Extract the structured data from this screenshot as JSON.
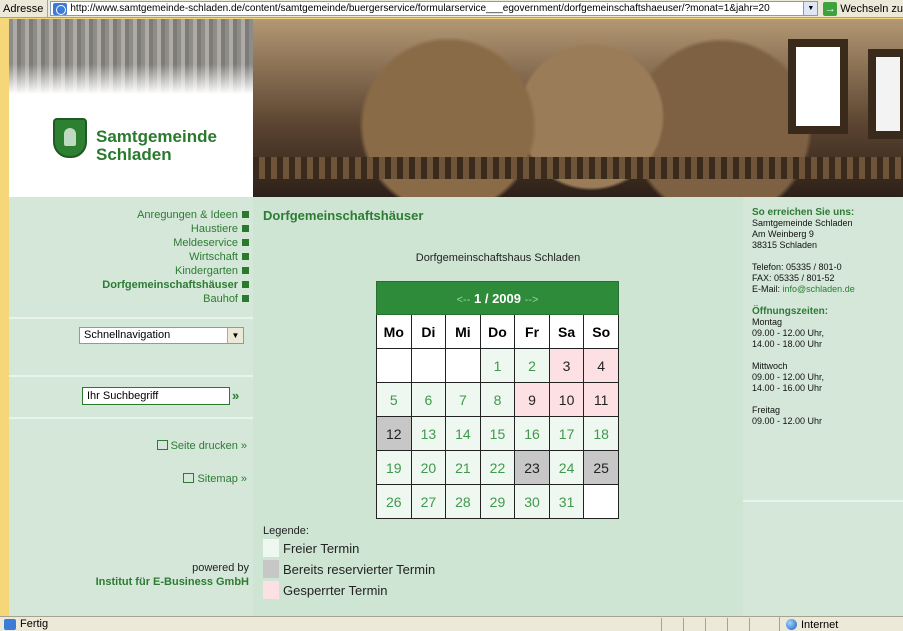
{
  "browser": {
    "address_label": "Adresse",
    "url": "http://www.samtgemeinde-schladen.de/content/samtgemeinde/buergerservice/formularservice___egovernment/dorfgemeinschaftshaeuser/?monat=1&jahr=20",
    "go_label": "Wechseln zu",
    "status_text": "Fertig",
    "zone_text": "Internet"
  },
  "brand": {
    "line1": "Samtgemeinde",
    "line2": "Schladen"
  },
  "nav": {
    "items": [
      {
        "label": "Anregungen & Ideen",
        "active": false
      },
      {
        "label": "Haustiere",
        "active": false
      },
      {
        "label": "Meldeservice",
        "active": false
      },
      {
        "label": "Wirtschaft",
        "active": false
      },
      {
        "label": "Kindergarten",
        "active": false
      },
      {
        "label": "Dorfgemeinschaftshäuser",
        "active": true
      },
      {
        "label": "Bauhof",
        "active": false
      }
    ],
    "quicknav_value": "Schnellnavigation",
    "search_value": "Ihr Suchbegriff",
    "search_go": "»",
    "print_label": "Seite drucken »",
    "sitemap_label": "Sitemap »",
    "powered_by": "powered by",
    "powered_company": "Institut für E-Business GmbH"
  },
  "main": {
    "title": "Dorfgemeinschaftshäuser",
    "house": "Dorfgemeinschaftshaus Schladen",
    "calendar": {
      "prev": "<--",
      "month_label": "1 / 2009",
      "next": "-->",
      "weekdays": [
        "Mo",
        "Di",
        "Mi",
        "Do",
        "Fr",
        "Sa",
        "So"
      ],
      "weeks": [
        [
          {
            "d": "",
            "s": "empty"
          },
          {
            "d": "",
            "s": "empty"
          },
          {
            "d": "",
            "s": "empty"
          },
          {
            "d": "1",
            "s": "free"
          },
          {
            "d": "2",
            "s": "free"
          },
          {
            "d": "3",
            "s": "blocked"
          },
          {
            "d": "4",
            "s": "blocked"
          }
        ],
        [
          {
            "d": "5",
            "s": "free"
          },
          {
            "d": "6",
            "s": "free"
          },
          {
            "d": "7",
            "s": "free"
          },
          {
            "d": "8",
            "s": "free"
          },
          {
            "d": "9",
            "s": "blocked"
          },
          {
            "d": "10",
            "s": "blocked"
          },
          {
            "d": "11",
            "s": "blocked"
          }
        ],
        [
          {
            "d": "12",
            "s": "reserved"
          },
          {
            "d": "13",
            "s": "free"
          },
          {
            "d": "14",
            "s": "free"
          },
          {
            "d": "15",
            "s": "free"
          },
          {
            "d": "16",
            "s": "free"
          },
          {
            "d": "17",
            "s": "free"
          },
          {
            "d": "18",
            "s": "free"
          }
        ],
        [
          {
            "d": "19",
            "s": "free"
          },
          {
            "d": "20",
            "s": "free"
          },
          {
            "d": "21",
            "s": "free"
          },
          {
            "d": "22",
            "s": "free"
          },
          {
            "d": "23",
            "s": "reserved"
          },
          {
            "d": "24",
            "s": "free"
          },
          {
            "d": "25",
            "s": "reserved"
          }
        ],
        [
          {
            "d": "26",
            "s": "free"
          },
          {
            "d": "27",
            "s": "free"
          },
          {
            "d": "28",
            "s": "free"
          },
          {
            "d": "29",
            "s": "free"
          },
          {
            "d": "30",
            "s": "free"
          },
          {
            "d": "31",
            "s": "free"
          },
          {
            "d": "",
            "s": "empty"
          }
        ]
      ]
    },
    "legend": {
      "title": "Legende:",
      "free": "Freier Termin",
      "reserved": "Bereits reservierter Termin",
      "blocked": "Gesperrter Termin"
    }
  },
  "contact": {
    "heading": "So erreichen Sie uns:",
    "org": "Samtgemeinde Schladen",
    "street": "Am Weinberg 9",
    "city": "38315 Schladen",
    "phone": "Telefon: 05335 / 801-0",
    "fax": "FAX: 05335 / 801-52",
    "email_label": "E-Mail: ",
    "email": "info@schladen.de",
    "hours_heading": "Öffnungszeiten:",
    "mon_label": "Montag",
    "mon_1": "09.00 - 12.00 Uhr,",
    "mon_2": "14.00 - 18.00 Uhr",
    "wed_label": "Mittwoch",
    "wed_1": "09.00 - 12.00 Uhr,",
    "wed_2": "14.00 - 16.00 Uhr",
    "fri_label": "Freitag",
    "fri_1": "09.00 - 12.00 Uhr"
  },
  "colors": {
    "brand_green": "#2e7b34",
    "free": "#eef7f0",
    "reserved": "#c7c7c7",
    "blocked": "#fde0e4"
  }
}
